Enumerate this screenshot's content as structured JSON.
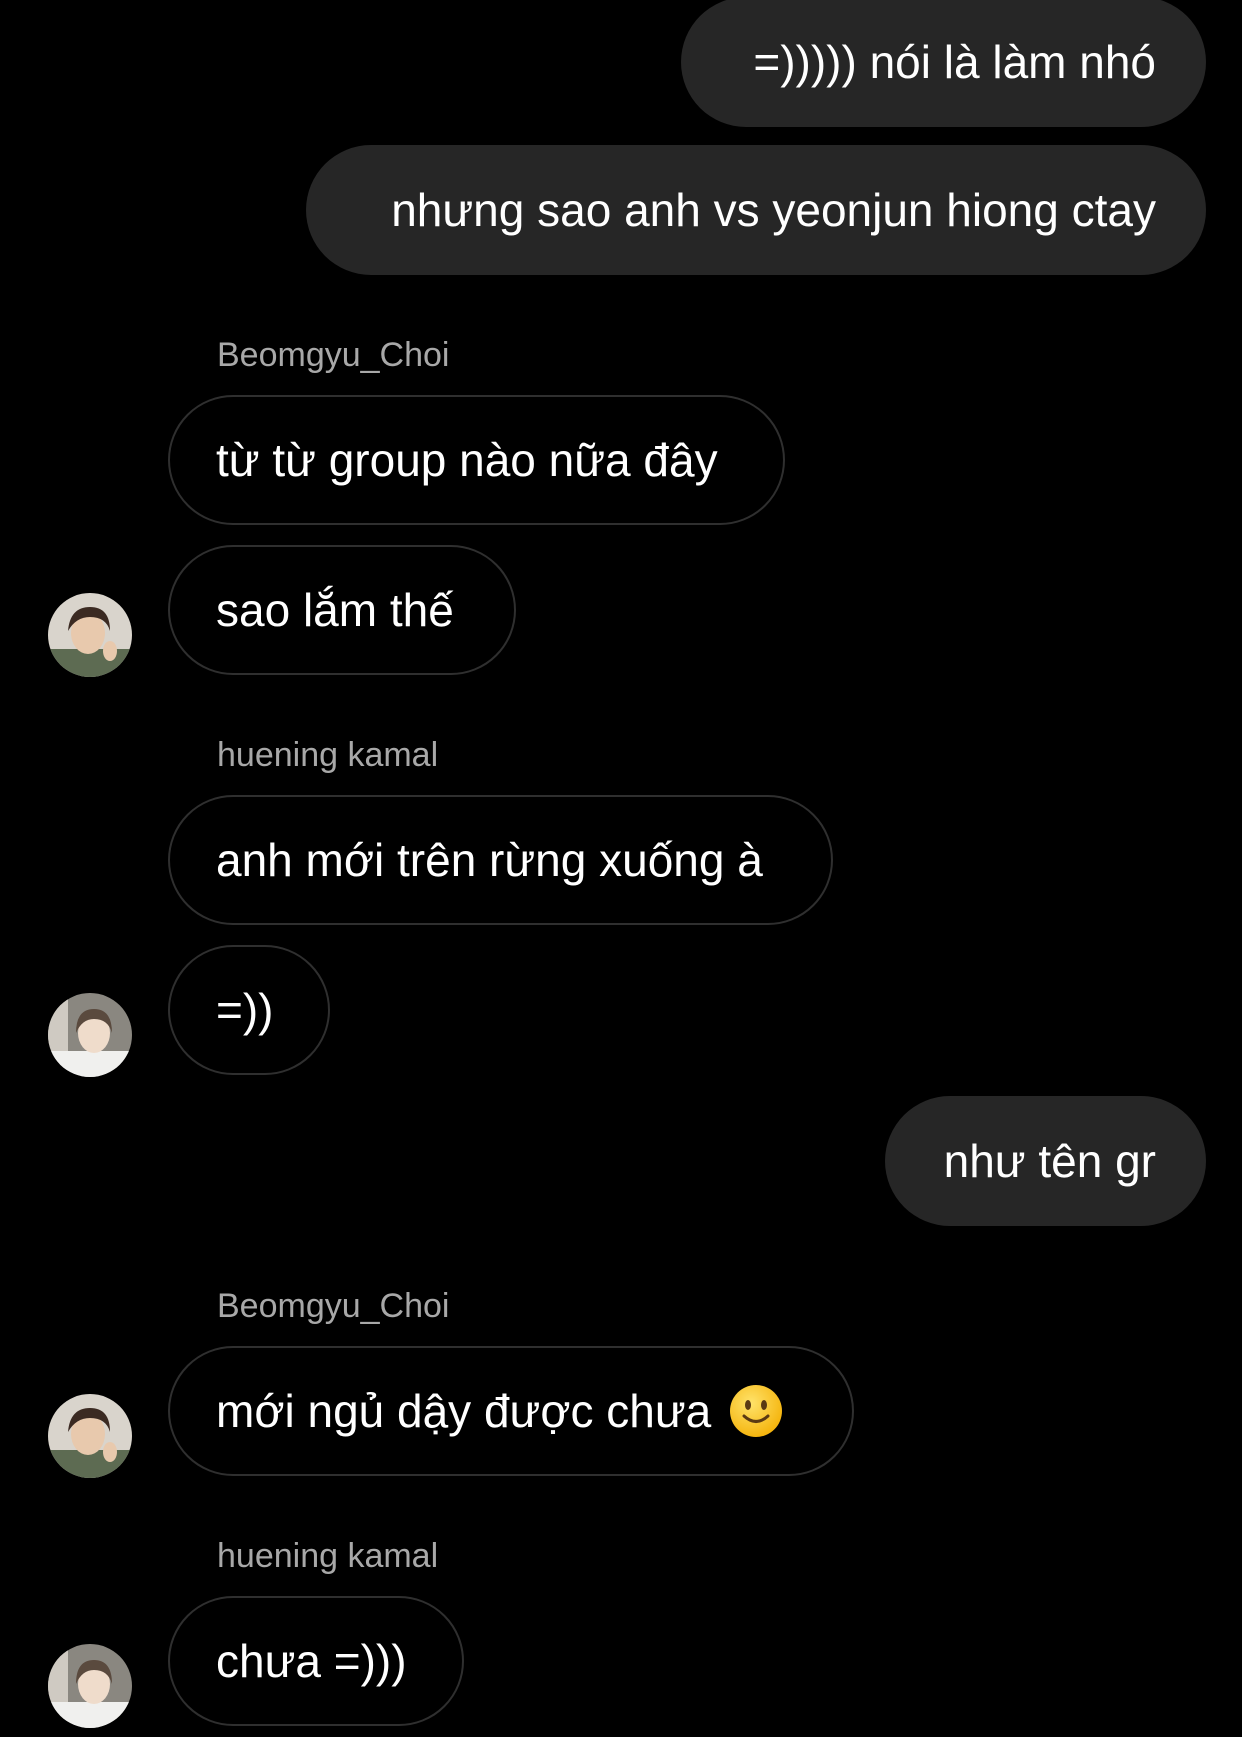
{
  "chat": {
    "messages": [
      {
        "type": "outgoing",
        "text": "=))))) nói là làm nhó"
      },
      {
        "type": "outgoing",
        "text": "nhưng sao anh vs yeonjun hiong ctay"
      },
      {
        "type": "sender",
        "name": "Beomgyu_Choi"
      },
      {
        "type": "incoming",
        "text": "từ từ group nào nữa đây"
      },
      {
        "type": "incoming",
        "text": "sao lắm thế",
        "avatar": "beomgyu-avatar"
      },
      {
        "type": "sender",
        "name": "huening kamal"
      },
      {
        "type": "incoming",
        "text": "anh mới trên rừng xuống à"
      },
      {
        "type": "incoming",
        "text": "=))",
        "avatar": "huening-avatar"
      },
      {
        "type": "outgoing",
        "text": "như tên gr"
      },
      {
        "type": "sender",
        "name": "Beomgyu_Choi"
      },
      {
        "type": "incoming",
        "text": "mới ngủ dậy được chưa",
        "emoji": "slightly-smiling-face-icon",
        "avatar": "beomgyu-avatar"
      },
      {
        "type": "sender",
        "name": "huening kamal"
      },
      {
        "type": "incoming",
        "text": "chưa =)))",
        "avatar": "huening-avatar"
      }
    ]
  },
  "colors": {
    "background": "#000000",
    "outgoing_bubble": "#262626",
    "incoming_border": "#2f2f2f",
    "sender_name": "#a8a8a8",
    "text": "#ffffff"
  }
}
